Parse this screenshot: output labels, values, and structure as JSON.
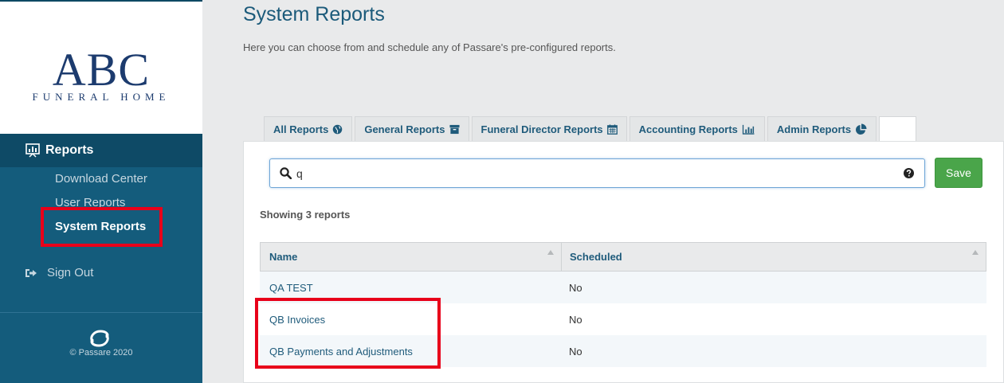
{
  "sidebar": {
    "logo_main": "ABC",
    "logo_sub": "FUNERAL HOME",
    "section_label": "Reports",
    "items": [
      {
        "label": "Download Center"
      },
      {
        "label": "User Reports"
      },
      {
        "label": "System Reports",
        "active": true
      }
    ],
    "signout_label": "Sign Out",
    "copyright": "© Passare 2020"
  },
  "main": {
    "title": "System Reports",
    "description": "Here you can choose from and schedule any of Passare's pre-configured reports.",
    "tabs": [
      {
        "label": "All Reports",
        "icon": "globe-icon"
      },
      {
        "label": "General Reports",
        "icon": "archive-icon"
      },
      {
        "label": "Funeral Director Reports",
        "icon": "calendar-icon"
      },
      {
        "label": "Accounting Reports",
        "icon": "bar-chart-icon"
      },
      {
        "label": "Admin Reports",
        "icon": "pie-chart-icon"
      }
    ],
    "search": {
      "value": "q",
      "placeholder": ""
    },
    "save_label": "Save",
    "showing": "Showing 3 reports",
    "table": {
      "headers": {
        "name": "Name",
        "scheduled": "Scheduled"
      },
      "rows": [
        {
          "name": "QA TEST",
          "scheduled": "No"
        },
        {
          "name": "QB Invoices",
          "scheduled": "No"
        },
        {
          "name": "QB Payments and Adjustments",
          "scheduled": "No"
        }
      ]
    }
  },
  "colors": {
    "sidebar_bg": "#145c7c",
    "sidebar_active_bg": "#0e4a66",
    "link": "#1f5b7b",
    "save_green": "#4aa54a",
    "highlight_red": "#e8001a"
  }
}
